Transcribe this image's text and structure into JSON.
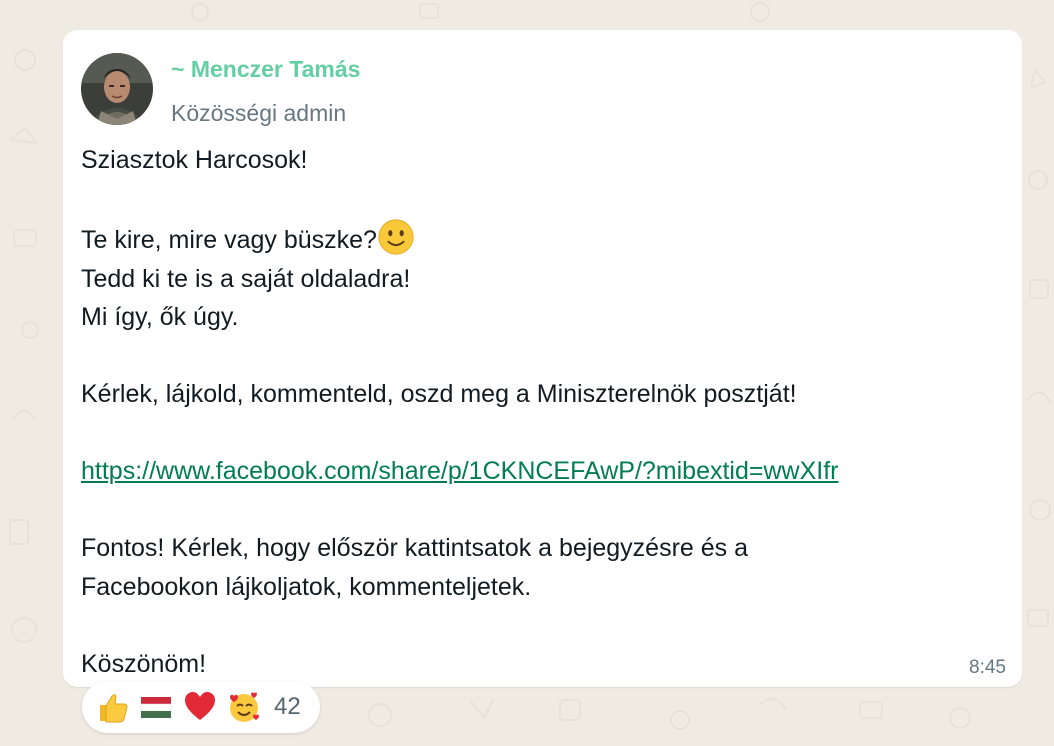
{
  "message": {
    "sender": "~ Menczer Tamás",
    "role": "Közösségi admin",
    "greeting": "Sziasztok Harcosok!",
    "line_question": "Te kire, mire vagy büszke?",
    "line_share": "Tedd ki te is a saját oldaladra!",
    "line_mi": "Mi így, ők úgy.",
    "line_request": "Kérlek, lájkold, kommenteld, oszd meg a Miniszterelnök posztját!",
    "link": "https://www.facebook.com/share/p/1CKNCEFAwP/?mibextid=wwXIfr",
    "important_line1": "Fontos! Kérlek, hogy először kattintsatok a bejegyzésre és a",
    "important_line2": "Facebookon lájkoljatok, kommenteljetek.",
    "thanks": "Köszönöm!",
    "time": "8:45"
  },
  "reactions": {
    "emojis": [
      "thumbs-up",
      "hungary-flag",
      "red-heart",
      "smiling-face-with-hearts"
    ],
    "count": "42"
  },
  "colors": {
    "sender": "#63cfa3",
    "link": "#027d52",
    "background": "#efeae2"
  }
}
